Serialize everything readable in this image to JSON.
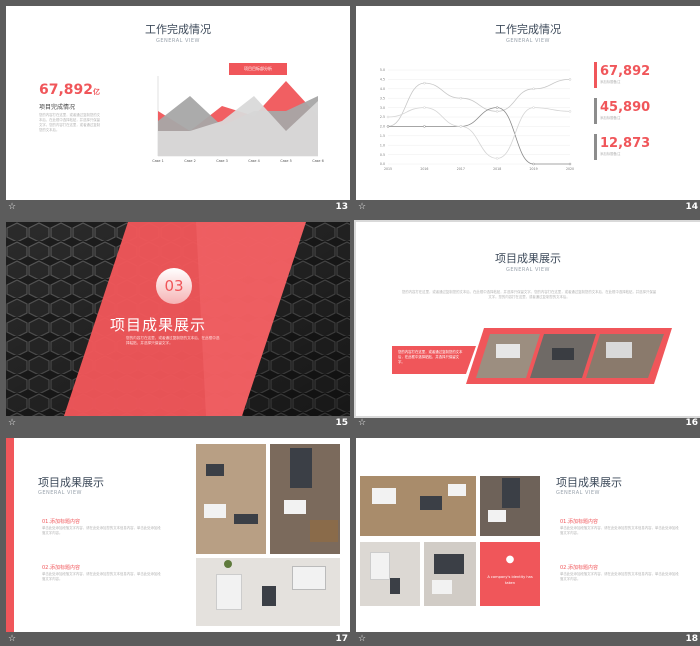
{
  "slides": [
    {
      "num": "13",
      "title": "工作完成情况",
      "subtitle": "GENERAL VIEW",
      "big_number": "67,892",
      "big_unit": "亿",
      "stat_label": "项目完成情况",
      "body": "您的内容打在这里，或者通过复制您的文本后，在此框中选择粘贴，并选择只保留文字。您的内容打在这里，或者通过复制您的文本后。",
      "callout": "项目目标部分析",
      "chart_data": {
        "type": "area",
        "categories": [
          "Case 1",
          "Case 2",
          "Case 3",
          "Case 4",
          "Case 5",
          "Case 6"
        ],
        "series": [
          {
            "values": [
              4.5,
              2.5,
              5.0,
              4.0,
              7.5,
              4.0
            ]
          },
          {
            "values": [
              3.5,
              6.0,
              3.0,
              4.5,
              4.5,
              6.0
            ]
          },
          {
            "values": [
              2.5,
              2.5,
              3.5,
              6.0,
              2.5,
              5.5
            ]
          }
        ],
        "colors": [
          "#f0565a",
          "#a6a6a6",
          "#d9d9d9"
        ]
      }
    },
    {
      "num": "14",
      "title": "工作完成情况",
      "subtitle": "GENERAL VIEW",
      "stats": [
        {
          "value": "67,892",
          "label": "添加标题备注"
        },
        {
          "value": "45,890",
          "label": "添加标题备注"
        },
        {
          "value": "12,873",
          "label": "添加标题备注"
        }
      ],
      "chart_data": {
        "type": "line",
        "categories": [
          "2015",
          "2016",
          "2017",
          "2018",
          "2019",
          "2020"
        ],
        "yticks": [
          "5.0",
          "4.5",
          "4.0",
          "3.5",
          "3.0",
          "2.5",
          "2.0",
          "1.5",
          "1.0",
          "0.5",
          "0.0"
        ],
        "ylim": [
          0,
          5
        ],
        "series": [
          {
            "values": [
              2.0,
              4.3,
              3.5,
              2.8,
              4.0,
              4.5
            ]
          },
          {
            "values": [
              2.0,
              2.0,
              2.0,
              3.0,
              0.0,
              0.0
            ]
          },
          {
            "values": [
              2.5,
              3.0,
              2.0,
              0.3,
              3.0,
              2.8
            ]
          }
        ]
      }
    },
    {
      "num": "15",
      "section_no": "03",
      "title": "项目成果展示",
      "body": "您的内容打在这里，或者通过复制您的文本后，在此框中选择粘贴，并选择只保留文字。"
    },
    {
      "num": "16",
      "title": "项目成果展示",
      "subtitle": "GENERAL VIEW",
      "body": "您的内容打在这里，或者通过复制您的文本后，在此框中选择粘贴，并选择只保留文字。您的内容打在这里，或者通过复制您的文本后，在此框中选择粘贴，并选择只保留文字。您的内容打在这里，或者通过复制您的文本后。",
      "band_text": "您的内容打在这里，或者通过复制您的文本后，在此框中选择粘贴，并选择只保留文字。"
    },
    {
      "num": "17",
      "title": "项目成果展示",
      "subtitle": "GENERAL VIEW",
      "items": [
        {
          "heading": "01.添加标题内容",
          "text": "单击此处添加段落文字内容，请在此处添加您的文本信息内容，单击此处添加段落文字内容。"
        },
        {
          "heading": "02.添加标题内容",
          "text": "单击此处添加段落文字内容，请在此处添加您的文本信息内容，单击此处添加段落文字内容。"
        }
      ]
    },
    {
      "num": "18",
      "title": "项目成果展示",
      "subtitle": "GENERAL VIEW",
      "items": [
        {
          "heading": "01.添加标题内容",
          "text": "单击此处添加段落文字内容，请在此处添加您的文本信息内容，单击此处添加段落文字内容。"
        },
        {
          "heading": "02.添加标题内容",
          "text": "单击此处添加段落文字内容，请在此处添加您的文本信息内容，单击此处添加段落文字内容。"
        }
      ],
      "tile_text": "A company's identity has taken"
    }
  ]
}
